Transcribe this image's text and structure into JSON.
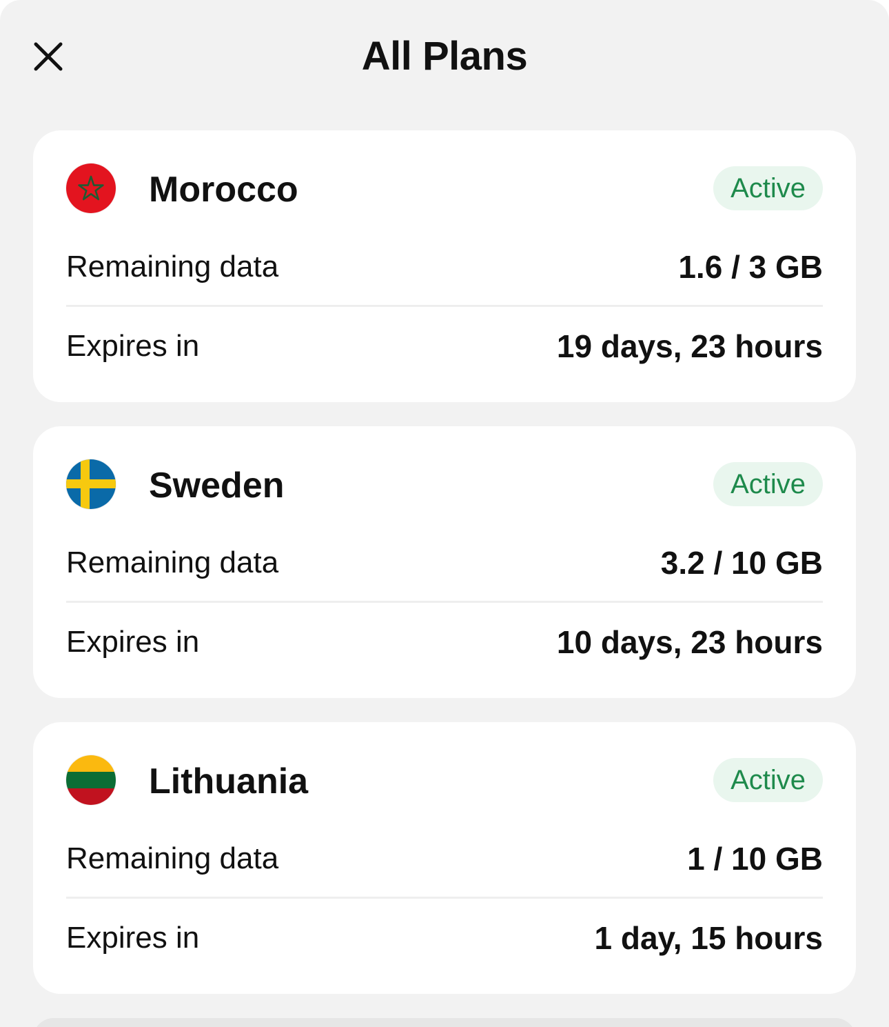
{
  "header": {
    "title": "All Plans",
    "close_icon": "close-icon"
  },
  "plans": [
    {
      "country": "Morocco",
      "flag_icon": "morocco-flag-icon",
      "status": "Active",
      "remaining_label": "Remaining data",
      "remaining_value": "1.6 / 3 GB",
      "expires_label": "Expires in",
      "expires_value": "19 days, 23 hours"
    },
    {
      "country": "Sweden",
      "flag_icon": "sweden-flag-icon",
      "status": "Active",
      "remaining_label": "Remaining data",
      "remaining_value": "3.2 / 10 GB",
      "expires_label": "Expires in",
      "expires_value": "10 days, 23 hours"
    },
    {
      "country": "Lithuania",
      "flag_icon": "lithuania-flag-icon",
      "status": "Active",
      "remaining_label": "Remaining data",
      "remaining_value": "1 / 10 GB",
      "expires_label": "Expires in",
      "expires_value": "1 day, 15 hours"
    }
  ],
  "colors": {
    "background": "#f2f2f2",
    "card": "#ffffff",
    "badge_bg": "#e9f6ee",
    "badge_text": "#1e8a4c"
  }
}
